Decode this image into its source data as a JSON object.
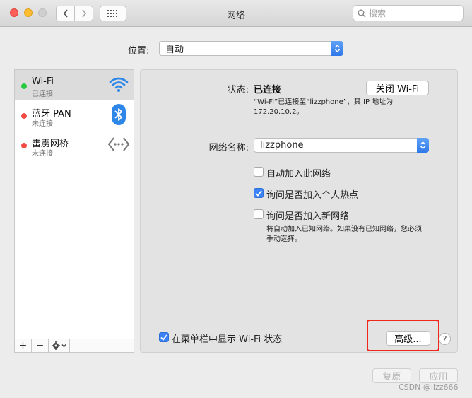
{
  "window": {
    "title": "网络"
  },
  "search": {
    "placeholder": "搜索",
    "icon": "search-icon"
  },
  "location": {
    "label": "位置:",
    "value": "自动"
  },
  "services": [
    {
      "name": "Wi-Fi",
      "status": "已连接",
      "status_color": "#28c840",
      "icon": "wifi-icon",
      "selected": true
    },
    {
      "name": "蓝牙 PAN",
      "status": "未连接",
      "status_color": "#f04b44",
      "icon": "bluetooth-icon",
      "selected": false
    },
    {
      "name": "雷雳网桥",
      "status": "未连接",
      "status_color": "#f04b44",
      "icon": "thunderbolt-bridge-icon",
      "selected": false
    }
  ],
  "sidebar_tools": {
    "add": "+",
    "remove": "−",
    "gear": "gear-icon"
  },
  "detail": {
    "status_label": "状态:",
    "status_value": "已连接",
    "toggle_button": "关闭 Wi-Fi",
    "status_desc_line1": "“Wi-Fi”已连接至“lizzphone”，其 IP 地址为",
    "status_desc_line2": "172.20.10.2。",
    "network_name_label": "网络名称:",
    "network_name_value": "lizzphone",
    "options": [
      {
        "label": "自动加入此网络",
        "checked": false
      },
      {
        "label": "询问是否加入个人热点",
        "checked": true
      },
      {
        "label": "询问是否加入新网络",
        "checked": false
      }
    ],
    "new_network_note_line1": "将自动加入已知网络。如果没有已知网络，您必须",
    "new_network_note_line2": "手动选择。",
    "show_menubar_label": "在菜单栏中显示 Wi-Fi 状态",
    "show_menubar_checked": true,
    "advanced_button": "高级...",
    "help": "?"
  },
  "footer": {
    "revert": "复原",
    "apply": "应用"
  },
  "watermark": "CSDN @lizz666",
  "colors": {
    "accent": "#3b82f6",
    "highlight": "#f0271b"
  }
}
